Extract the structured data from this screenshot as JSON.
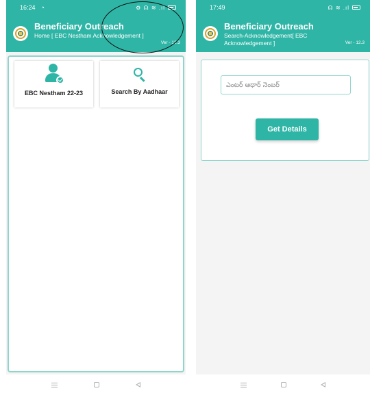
{
  "screens": [
    {
      "status": {
        "time": "16:24",
        "icons": "⚙ ☊ ≋ .ıl"
      },
      "appbar": {
        "title": "Beneficiary Outreach",
        "subtitle": "Home [ EBC Nestham Acknowledgement ]",
        "version": "Ver - 12.3"
      },
      "tiles": [
        {
          "label": "EBC Nestham 22-23",
          "icon": "user-check-icon"
        },
        {
          "label": "Search By Aadhaar",
          "icon": "search-icon"
        }
      ]
    },
    {
      "status": {
        "time": "17:49",
        "icons": "☊ ≋ .ıl"
      },
      "appbar": {
        "title": "Beneficiary Outreach",
        "subtitle_line1": "Search-Acknowledgement[ EBC",
        "subtitle_line2": "Acknowledgement ]",
        "version": "Ver - 12.3"
      },
      "form": {
        "aadhaar_placeholder": "ఎంటర్ ఆధార్ నెంబర్",
        "button_label": "Get Details"
      }
    }
  ],
  "colors": {
    "primary": "#2fb5a6",
    "border": "#8fd5cc"
  }
}
